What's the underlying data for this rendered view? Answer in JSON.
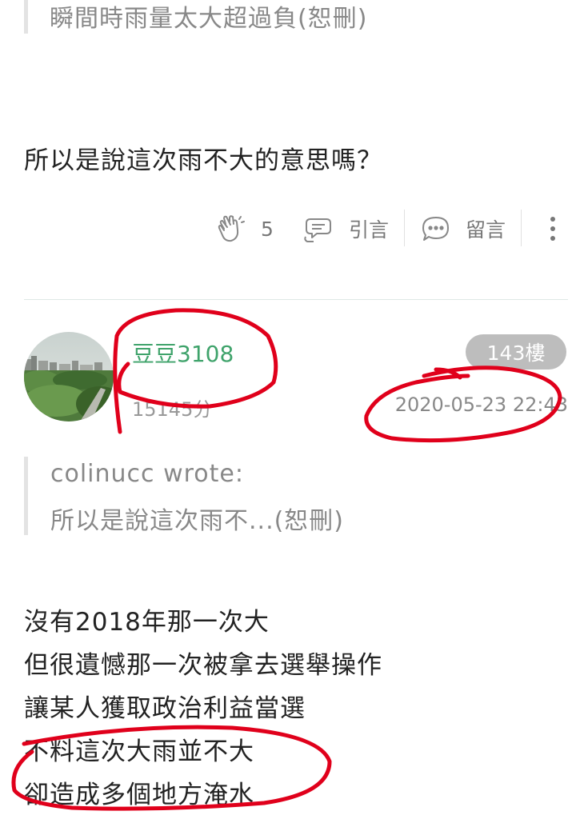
{
  "prev_post": {
    "quote_snippet": "瞬間時雨量太大超過負(恕刪)",
    "body": "所以是說這次雨不大的意思嗎？",
    "actions": {
      "like_count": "5",
      "quote_label": "引言",
      "comment_label": "留言"
    }
  },
  "post": {
    "username": "豆豆3108",
    "score": "15145分",
    "floor": "143樓",
    "datetime": "2020-05-23 22:43",
    "quote": {
      "author_line": "colinucc wrote:",
      "snippet": "所以是說這次雨不...(恕刪)"
    },
    "body_lines": [
      "沒有2018年那一次大",
      "但很遺憾那一次被拿去選舉操作",
      "讓某人獲取政治利益當選",
      "不料這次大雨並不大",
      "卻造成多個地方淹水"
    ]
  },
  "colors": {
    "username": "#3fa36b",
    "floor_badge": "#bdbdbd",
    "annotation": "#e0001b"
  }
}
